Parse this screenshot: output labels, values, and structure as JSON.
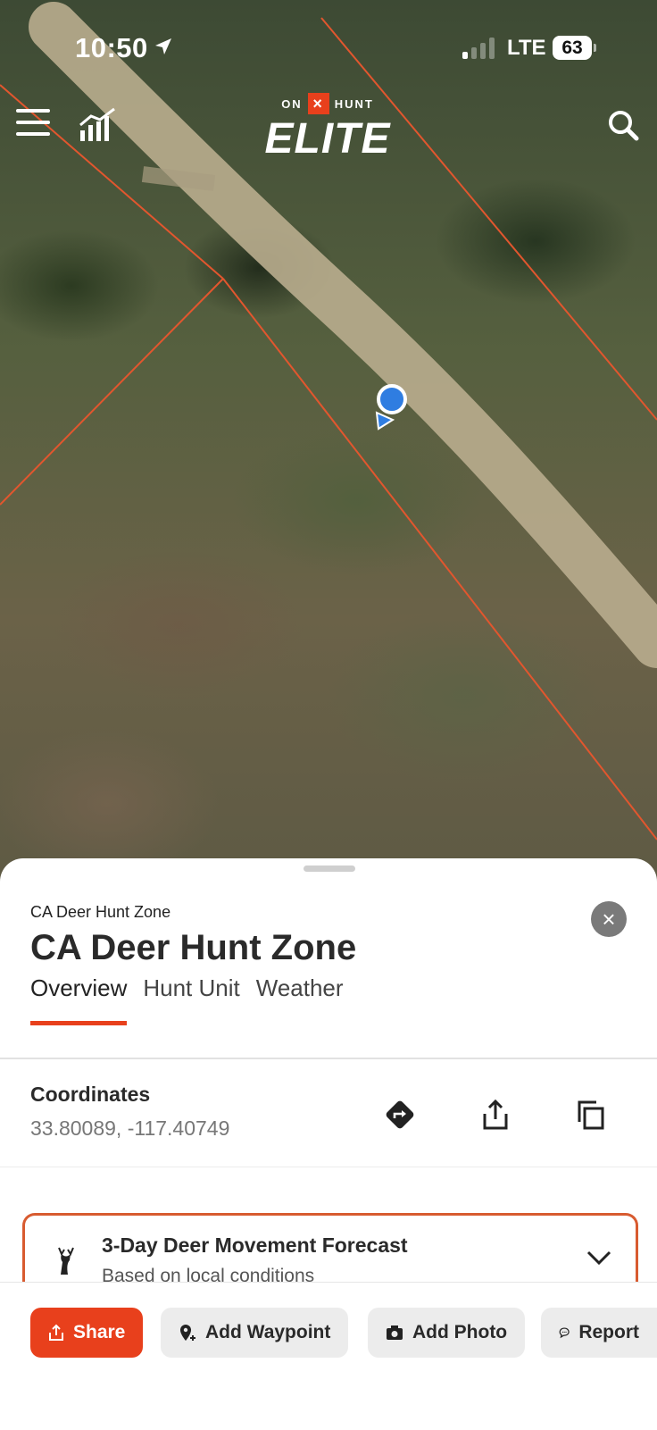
{
  "status_bar": {
    "time": "10:50",
    "network": "LTE",
    "battery": "63"
  },
  "header": {
    "logo_small_left": "ON",
    "logo_x": "×",
    "logo_small_right": "HUNT",
    "logo_main": "ELITE"
  },
  "sheet": {
    "subtitle": "CA Deer Hunt Zone",
    "title": "CA Deer Hunt Zone",
    "close_icon": "×",
    "tabs": [
      {
        "label": "Overview",
        "active": true
      },
      {
        "label": "Hunt Unit",
        "active": false
      },
      {
        "label": "Weather",
        "active": false
      }
    ],
    "coordinates": {
      "label": "Coordinates",
      "value": "33.80089, -117.40749"
    },
    "forecast": {
      "title": "3-Day Deer Movement Forecast",
      "subtitle": "Based on local conditions"
    }
  },
  "actions": {
    "share": "Share",
    "add_waypoint": "Add Waypoint",
    "add_photo": "Add Photo",
    "report": "Report"
  },
  "colors": {
    "accent": "#e8401c",
    "user_location": "#2f7de1",
    "boundary": "#e2562e"
  }
}
